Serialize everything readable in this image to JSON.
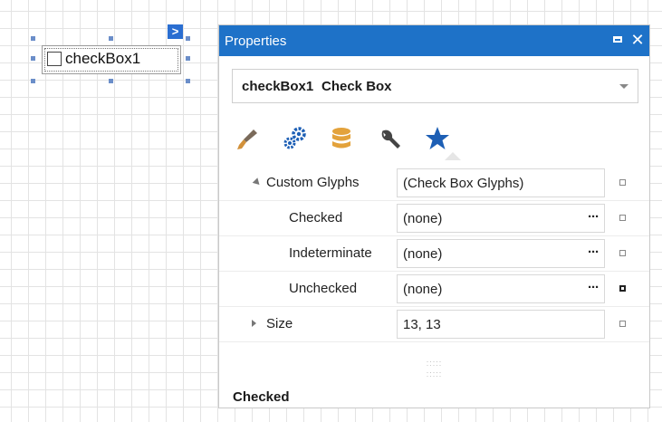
{
  "designer": {
    "control_label": "checkBox1",
    "smart_tag": ">"
  },
  "properties_window": {
    "title": "Properties",
    "window_buttons": [
      "maximize-icon",
      "close-icon"
    ],
    "close_glyph": "✕",
    "selected_object": {
      "name": "checkBox1",
      "type": "Check Box"
    },
    "tabs": [
      "appearance-icon",
      "behavior-icon",
      "data-icon",
      "layout-icon",
      "favorites-icon"
    ],
    "rows": [
      {
        "label": "Custom Glyphs",
        "value": "(Check Box Glyphs)",
        "expander": "expanded",
        "ellipsis": ""
      },
      {
        "label": "Checked",
        "value": "(none)",
        "ellipsis": "···"
      },
      {
        "label": "Indeterminate",
        "value": "(none)",
        "ellipsis": "···"
      },
      {
        "label": "Unchecked",
        "value": "(none)",
        "ellipsis": "···"
      },
      {
        "label": "Size",
        "value": "13, 13",
        "expander": "collapsed",
        "ellipsis": ""
      }
    ],
    "description_title": "Checked"
  },
  "colors": {
    "title_bar": "#1e72c8",
    "favorites_star": "#1d5fb5",
    "brush": "#d2913a",
    "database": "#e3a23b"
  }
}
